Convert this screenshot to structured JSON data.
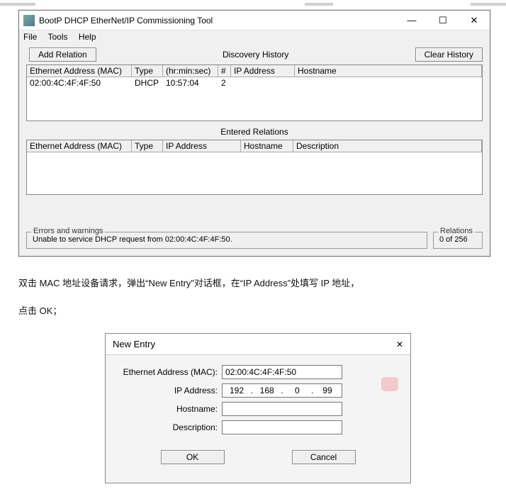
{
  "window": {
    "title": "BootP DHCP EtherNet/IP Commissioning Tool",
    "menu": {
      "file": "File",
      "tools": "Tools",
      "help": "Help"
    },
    "winctrl": {
      "min": "—",
      "max": "☐",
      "close": "✕"
    },
    "add_relation": "Add Relation",
    "discovery_label": "Discovery History",
    "clear_history": "Clear History",
    "discovery_cols": {
      "mac": "Ethernet Address (MAC)",
      "type": "Type",
      "hms": "(hr:min:sec)",
      "num": "#",
      "ip": "IP Address",
      "host": "Hostname"
    },
    "discovery_row": {
      "mac": "02:00:4C:4F:4F:50",
      "type": "DHCP",
      "hms": "10:57:04",
      "num": "2",
      "ip": "",
      "host": ""
    },
    "entered_label": "Entered Relations",
    "rel_cols": {
      "mac": "Ethernet Address (MAC)",
      "type": "Type",
      "ip": "IP Address",
      "host": "Hostname",
      "desc": "Description"
    },
    "errors": {
      "legend": "Errors and warnings",
      "msg": "Unable to service DHCP request from 02:00:4C:4F:4F:50."
    },
    "relations": {
      "legend": "Relations",
      "count": "0 of 256"
    }
  },
  "instructions": {
    "p1": "双击 MAC 地址设备请求，弹出“New Entry”对话框，在“IP Address”处填写 IP 地址，",
    "p2": "点击 OK；"
  },
  "dialog": {
    "title": "New Entry",
    "close": "✕",
    "labels": {
      "mac": "Ethernet Address (MAC):",
      "ip": "IP Address:",
      "host": "Hostname:",
      "desc": "Description:"
    },
    "values": {
      "mac": "02:00:4C:4F:4F:50",
      "ip_o1": "192",
      "ip_o2": "168",
      "ip_o3": "0",
      "ip_o4": "99",
      "host": "",
      "desc": ""
    },
    "buttons": {
      "ok": "OK",
      "cancel": "Cancel"
    }
  }
}
